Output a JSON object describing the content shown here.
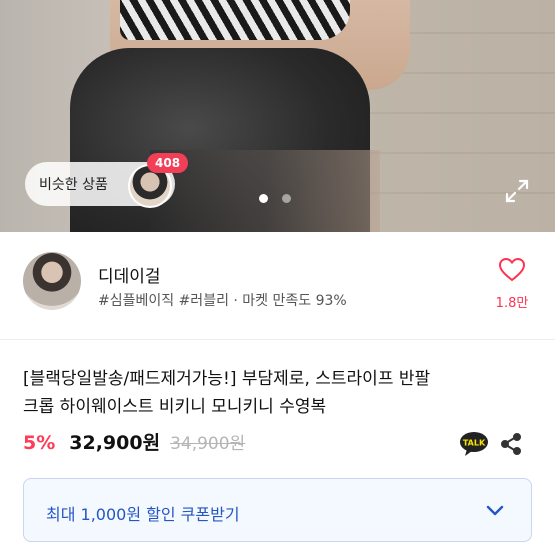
{
  "hero": {
    "similar_label": "비슷한 상품",
    "similar_count": "408"
  },
  "seller": {
    "name": "디데이걸",
    "tags": "#심플베이직 #러블리 · 마켓 만족도 93%",
    "likes": "1.8만"
  },
  "product": {
    "title_line1": "[블랙당일발송/패드제거가능!] 부담제로, 스트라이프 반팔",
    "title_line2": "크롭 하이웨이스트 비키니 모니키니 수영복",
    "discount": "5%",
    "price": "32,900원",
    "original_price": "34,900원"
  },
  "coupon": {
    "label": "최대 1,000원 할인 쿠폰받기"
  },
  "colors": {
    "accent_red": "#ff3b57",
    "coupon_blue": "#2457c5"
  }
}
